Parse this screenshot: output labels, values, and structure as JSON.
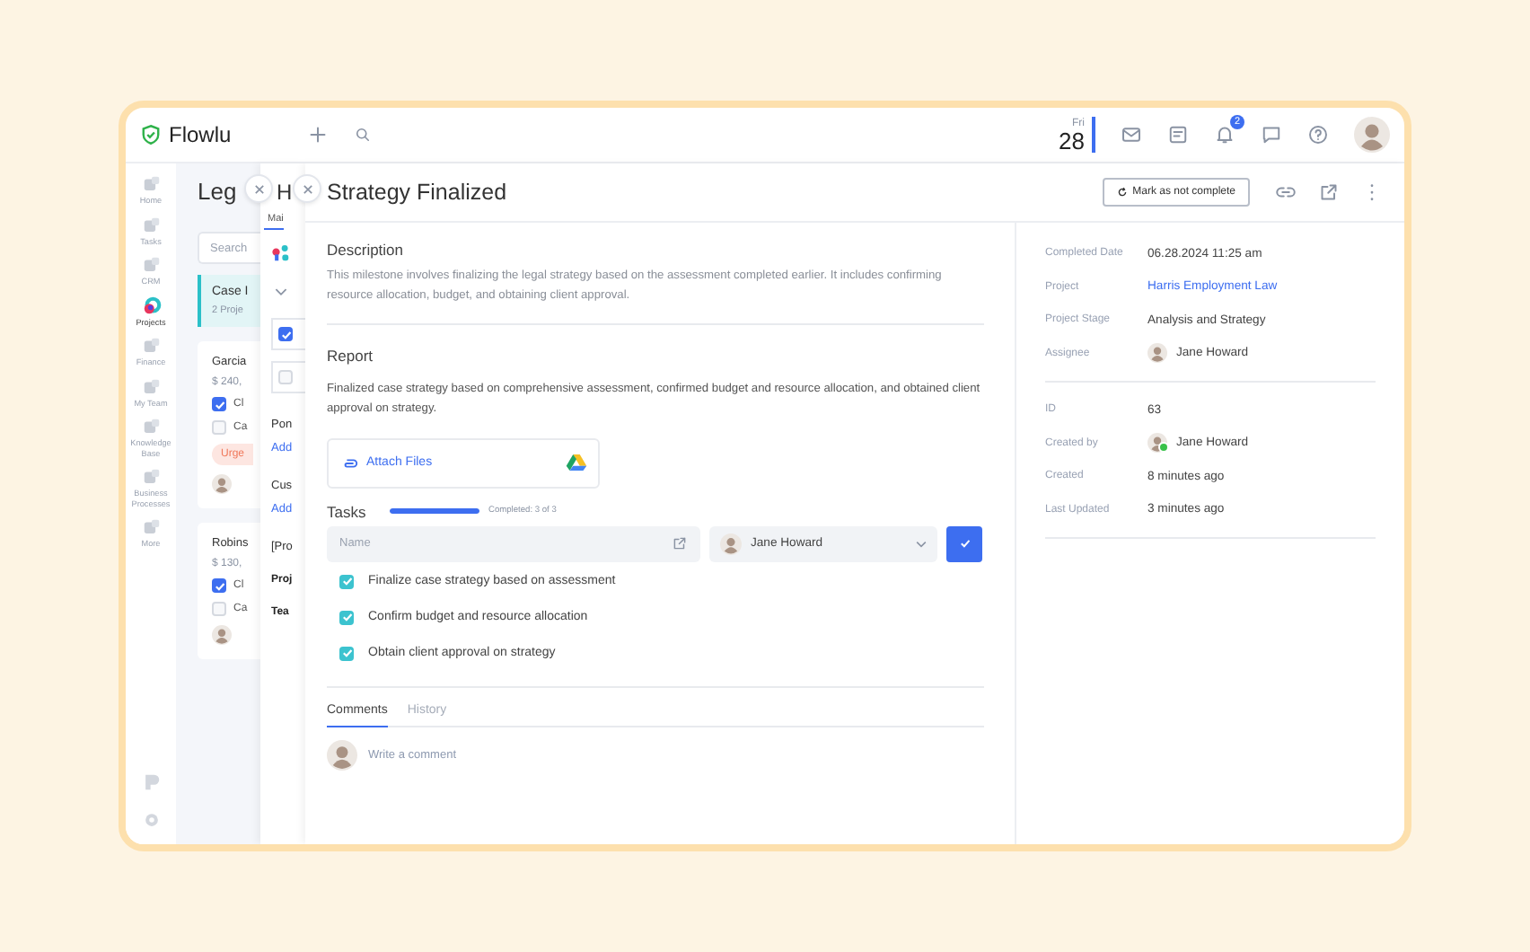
{
  "topbar": {
    "logo": "Flowlu",
    "day": "Fri",
    "date": "28",
    "notification_count": "2"
  },
  "sidebar": {
    "items": [
      {
        "label": "Home",
        "selected": false
      },
      {
        "label": "Tasks",
        "selected": false
      },
      {
        "label": "CRM",
        "selected": false
      },
      {
        "label": "Projects",
        "selected": true
      },
      {
        "label": "Finance",
        "selected": false
      },
      {
        "label": "My Team",
        "selected": false
      },
      {
        "label": "Knowledge Base",
        "selected": false
      },
      {
        "label": "Business Processes",
        "selected": false
      },
      {
        "label": "More",
        "selected": false
      }
    ]
  },
  "project_list_panel": {
    "title": "Leg",
    "search_placeholder": "Search",
    "stage": {
      "title": "Case I",
      "subtitle": "2 Proje"
    },
    "cards": [
      {
        "title": "Garcia",
        "amount": "$ 240,",
        "checks": [
          {
            "label": "Cl",
            "checked": true
          },
          {
            "label": "Ca",
            "checked": false
          }
        ],
        "badge": "Urge"
      },
      {
        "title": "Robins",
        "amount": "$ 130,",
        "checks": [
          {
            "label": "Cl",
            "checked": true
          },
          {
            "label": "Ca",
            "checked": false
          }
        ]
      }
    ]
  },
  "project_panel": {
    "title": "H",
    "tab": "Mai",
    "checks": [
      {
        "checked": true
      },
      {
        "checked": false
      }
    ],
    "items": [
      {
        "kind": "label",
        "text": "Pon"
      },
      {
        "kind": "link",
        "text": "Add"
      },
      {
        "kind": "label",
        "text": "Cus"
      },
      {
        "kind": "link",
        "text": "Add"
      },
      {
        "kind": "label",
        "text": "[Pro"
      },
      {
        "kind": "heading",
        "text": "Proj"
      },
      {
        "kind": "heading",
        "text": "Tea"
      }
    ]
  },
  "milestone": {
    "title": "Strategy Finalized",
    "mark_button": "Mark as not complete",
    "description": {
      "heading": "Description",
      "text": "This milestone involves finalizing the legal strategy based on the assessment completed earlier. It includes confirming resource allocation, budget, and obtaining client approval."
    },
    "report": {
      "heading": "Report",
      "text": "Finalized case strategy based on comprehensive assessment, confirmed budget and resource allocation, and obtained client approval on strategy."
    },
    "attach_label": "Attach Files",
    "tasks": {
      "heading": "Tasks",
      "level": 1,
      "progress_text": "Completed: 3 of 3",
      "name_placeholder": "Name",
      "assignee": "Jane Howard",
      "items": [
        {
          "label": "Finalize case strategy based on assessment",
          "checked": true
        },
        {
          "label": "Confirm budget and resource allocation",
          "checked": true
        },
        {
          "label": "Obtain client approval on strategy",
          "checked": true
        }
      ]
    },
    "tabs": [
      {
        "label": "Comments",
        "selected": true
      },
      {
        "label": "History",
        "selected": false
      }
    ],
    "comment_placeholder": "Write a comment"
  },
  "details": {
    "groups": [
      [
        {
          "label": "Completed Date",
          "value": "06.28.2024 11:25 am",
          "kind": "text"
        },
        {
          "label": "Project",
          "value": "Harris Employment Law",
          "kind": "link"
        },
        {
          "label": "Project Stage",
          "value": "Analysis and Strategy",
          "kind": "text"
        },
        {
          "label": "Assignee",
          "value": "Jane Howard",
          "kind": "person",
          "online": false
        }
      ],
      [
        {
          "label": "ID",
          "value": "63",
          "kind": "text"
        },
        {
          "label": "Created by",
          "value": "Jane Howard",
          "kind": "person",
          "online": true
        },
        {
          "label": "Created",
          "value": "8 minutes ago",
          "kind": "text"
        },
        {
          "label": "Last Updated",
          "value": "3 minutes ago",
          "kind": "text"
        }
      ]
    ]
  }
}
